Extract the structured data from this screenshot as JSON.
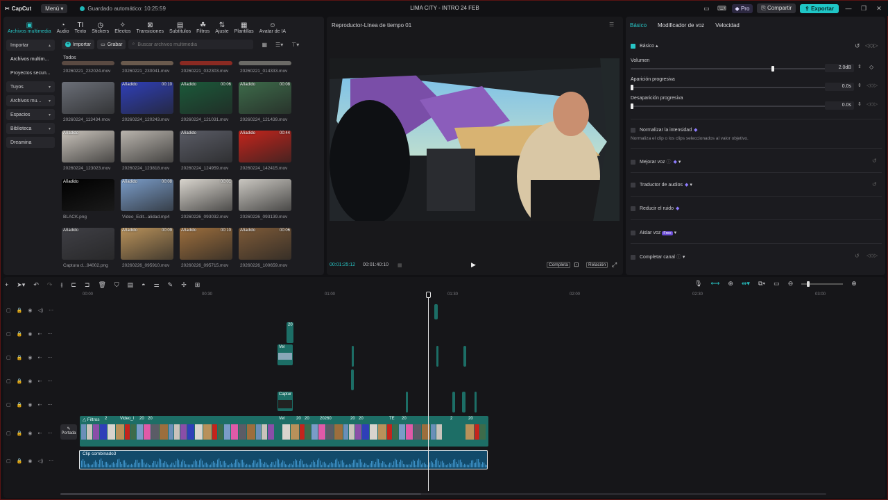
{
  "app": {
    "logo_text": "CapCut",
    "menu_label": "Menú",
    "autosave_text": "Guardado automático: 10:25:59",
    "project_title": "LIMA CITY - INTRO 24 FEB",
    "pro_label": "Pro",
    "share_label": "Compartir",
    "export_label": "Exportar"
  },
  "toolbar": {
    "items": [
      "Archivos multimedia",
      "Audio",
      "Texto",
      "Stickers",
      "Efectos",
      "Transiciones",
      "Subtítulos",
      "Filtros",
      "Ajuste",
      "Plantillas",
      "Avatar de IA"
    ]
  },
  "sidebar": {
    "items": [
      "Importar",
      "Archivos multim...",
      "Proyectos secun...",
      "Tuyos",
      "Archivos mu...",
      "Espacios",
      "Biblioteca",
      "Dreamina"
    ]
  },
  "media": {
    "import_label": "Importar",
    "record_label": "Grabar",
    "search_placeholder": "Buscar archivos multimedia",
    "filter_label": "Todos",
    "top_captions": [
      "20260221_232024.mov",
      "20260221_230041.mov",
      "20260221_032303.mov",
      "20260221_014333.mov"
    ],
    "items": [
      {
        "tag": "",
        "dur": "",
        "name": "20260224_113434.mov"
      },
      {
        "tag": "Añadido",
        "dur": "00:10",
        "name": "20260224_120243.mov"
      },
      {
        "tag": "Añadido",
        "dur": "00:06",
        "name": "20260224_121031.mov"
      },
      {
        "tag": "Añadido",
        "dur": "00:08",
        "name": "20260224_121439.mov"
      },
      {
        "tag": "Añadido",
        "dur": "",
        "name": "20260224_123023.mov"
      },
      {
        "tag": "",
        "dur": "",
        "name": "20260224_123818.mov"
      },
      {
        "tag": "Añadido",
        "dur": "",
        "name": "20260224_124959.mov"
      },
      {
        "tag": "Añadido",
        "dur": "00:44",
        "name": "20260224_142415.mov"
      },
      {
        "tag": "Añadido",
        "dur": "",
        "name": "BLACK.png"
      },
      {
        "tag": "Añadido",
        "dur": "00:08",
        "name": "Video_Edit...alidad.mp4"
      },
      {
        "tag": "",
        "dur": "00:01",
        "name": "20260226_093032.mov"
      },
      {
        "tag": "",
        "dur": "",
        "name": "20260226_093139.mov"
      },
      {
        "tag": "Añadido",
        "dur": "",
        "name": "Captura d...94002.png"
      },
      {
        "tag": "Añadido",
        "dur": "00:09",
        "name": "20260226_095910.mov"
      },
      {
        "tag": "Añadido",
        "dur": "00:10",
        "name": "20260226_095715.mov"
      },
      {
        "tag": "Añadido",
        "dur": "00:06",
        "name": "20260226_100659.mov"
      }
    ],
    "colors": [
      "#6b6f78",
      "#2f3fb8",
      "#1b5a3a",
      "#3d6b4a",
      "#c9c3bb",
      "#b9b4ad",
      "#5a5c66",
      "#c4241c",
      "#000000",
      "#7a9cc8",
      "#d8d4cd",
      "#c9c6c0",
      "#3f3f45",
      "#b8915a",
      "#9c6e3d",
      "#7d5a38"
    ],
    "top_colors": [
      "#5a4a42",
      "#6a5a4d",
      "#8a2a22",
      "#6b6a66"
    ]
  },
  "player": {
    "title": "Reproductor-Línea de tiempo 01",
    "current_time": "00:01:25:12",
    "total_time": "00:01:40:10",
    "btn_full": "Completa",
    "btn_ratio": "Relación"
  },
  "inspector": {
    "tabs": [
      "Básico",
      "Modificador de voz",
      "Velocidad"
    ],
    "section": "Básico",
    "volume_label": "Volumen",
    "volume_value": "2.0dB",
    "volume_level": 0.72,
    "fadein_label": "Aparición progresiva",
    "fadein_value": "0.0s",
    "fadeout_label": "Desaparición progresiva",
    "fadeout_value": "0.0s",
    "normalize_label": "Normalizar la intensidad",
    "normalize_desc": "Normaliza el clip o los clips seleccionados al valor objetivo.",
    "options": [
      "Mejorar voz",
      "Traductor de audios",
      "Reducir el ruido",
      "Aislar voz",
      "Completar canal"
    ],
    "free_badge": "Free"
  },
  "timeline": {
    "ruler": [
      "00:00",
      "00:30",
      "01:00",
      "01:30",
      "02:00",
      "02:30",
      "03:00"
    ],
    "cover_label": "Portada",
    "main_clip_label": "Filtros",
    "audio_clip_label": "Clip combinado3",
    "small_labels": [
      "20",
      "Vel",
      "Captur"
    ],
    "main_strip_labels": [
      "2",
      "Video_l",
      "20",
      "20",
      "Vel",
      "20",
      "20",
      "20260",
      "20",
      "20",
      "TE",
      "20",
      "2",
      "20"
    ]
  }
}
